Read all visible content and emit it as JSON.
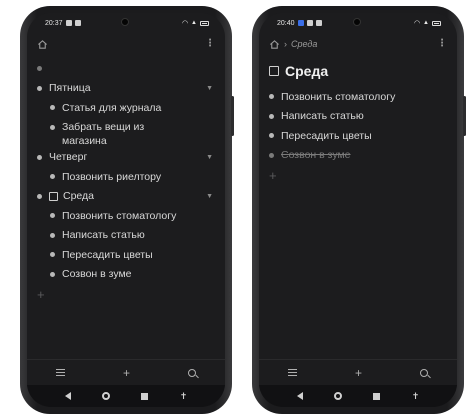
{
  "left": {
    "status": {
      "time": "20:37"
    },
    "items": {
      "friday": "Пятница",
      "journal": "Статья для журнала",
      "pickup_line1": "Забрать вещи из",
      "pickup_line2": "магазина",
      "thursday": "Четверг",
      "realtor": "Позвонить риелтору",
      "wednesday": "Среда",
      "dentist": "Позвонить стоматологу",
      "article": "Написать статью",
      "flowers": "Пересадить цветы",
      "zoom": "Созвон в зуме"
    },
    "add_glyph": "+"
  },
  "right": {
    "status": {
      "time": "20:40"
    },
    "breadcrumb": "Среда",
    "title": "Среда",
    "items": {
      "dentist": "Позвонить стоматологу",
      "article": "Написать статью",
      "flowers": "Пересадить цветы",
      "zoom": "Созвон в зуме"
    },
    "add_glyph": "+"
  },
  "toolbar": {
    "add_glyph": "+"
  },
  "icons": {
    "home": "home-icon",
    "more": "more-vertical-icon",
    "menu": "menu-icon",
    "add": "plus-icon",
    "search": "search-icon",
    "chevron": "chevron-down-icon",
    "back": "nav-back-icon",
    "nav_home": "nav-home-icon",
    "recents": "nav-recents-icon",
    "accessibility": "accessibility-icon"
  }
}
